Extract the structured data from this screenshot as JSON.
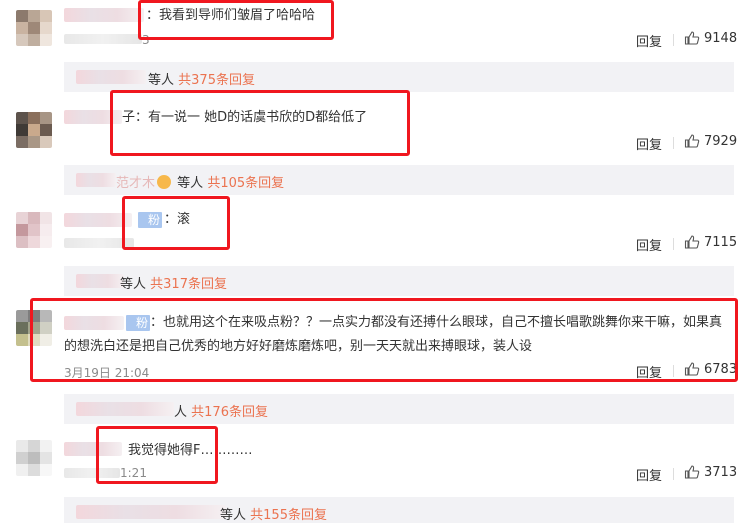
{
  "comments": [
    {
      "text": "：我看到导师们皱眉了哈哈哈",
      "time_fragment": "3",
      "reply_label": "回复",
      "likes": "9148",
      "sub_label": "等人",
      "sub_count": "共375条回复"
    },
    {
      "text": "子：有一说一   她D的话虞书欣的D都给低了",
      "reply_label": "回复",
      "likes": "7929",
      "sub_prefix": "范才木",
      "sub_label": "等人",
      "sub_count": "共105条回复"
    },
    {
      "tag": "粉",
      "text": "：滚",
      "reply_label": "回复",
      "likes": "7115",
      "sub_label": "等人",
      "sub_count": "共317条回复"
    },
    {
      "tag": "粉",
      "text_line1": "：也就用这个在来吸点粉？？一点实力都没有还搏什么眼球，自己不擅长唱歌跳舞你来干嘛，如果真",
      "text_line2": "的想洗白还是把自己优秀的地方好好磨炼磨炼吧，别一天天就出来搏眼球，装人设",
      "time": "3月19日 21:04",
      "reply_label": "回复",
      "likes": "6783",
      "sub_label": "人",
      "sub_count": "共176条回复"
    },
    {
      "text": "我觉得她得F…………",
      "time_fragment": "1:21",
      "reply_label": "回复",
      "likes": "3713",
      "sub_label": "等人",
      "sub_count": "共155条回复"
    }
  ],
  "colors": {
    "red_box": "#f0171f",
    "reply_count": "#eb7350",
    "subbox_bg": "#f2f2f5"
  }
}
